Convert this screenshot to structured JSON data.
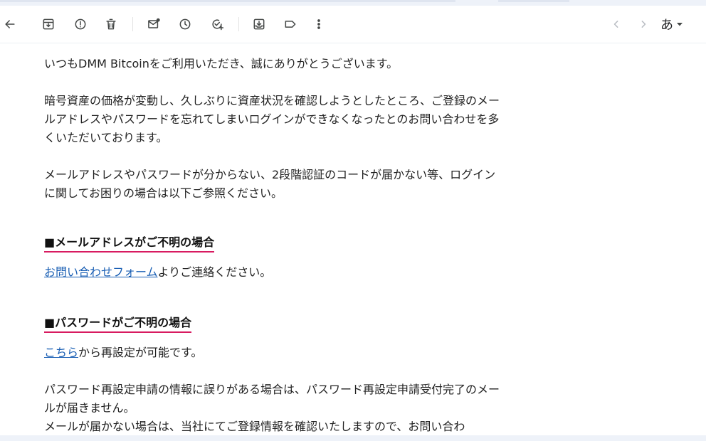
{
  "toolbar": {
    "icons": {
      "back": "arrow-left-icon",
      "archive": "archive-icon",
      "spam": "report-spam-icon",
      "delete": "trash-icon",
      "mark_unread": "mark-unread-icon",
      "snooze": "clock-icon",
      "add_task": "add-task-icon",
      "move": "move-to-icon",
      "label": "label-icon",
      "more": "more-vert-icon",
      "newer": "chevron-left-icon",
      "older": "chevron-right-icon"
    },
    "ime_label": "あ"
  },
  "email": {
    "line1": "いつもDMM Bitcoinをご利用いただき、誠にありがとうございます。",
    "para2": "暗号資産の価格が変動し、久しぶりに資産状況を確認しようとしたところ、ご登録のメールアドレスやパスワードを忘れてしまいログインができなくなったとのお問い合わせを多くいただいております。",
    "para3": "メールアドレスやパスワードが分からない、2段階認証のコードが届かない等、ログインに関してお困りの場合は以下ご参照ください。",
    "section1": {
      "heading": "■メールアドレスがご不明の場合",
      "link": "お問い合わせフォーム",
      "text": "よりご連絡ください。"
    },
    "section2": {
      "heading": "■パスワードがご不明の場合",
      "link": "こちら",
      "text": "から再設定が可能です。"
    },
    "para4": "パスワード再設定申請の情報に誤りがある場合は、パスワード再設定申請受付完了のメールが届きません。\nメールが届かない場合は、当社にてご登録情報を確認いたしますので、お問い合わ"
  },
  "colors": {
    "heading_underline": "#d81b60",
    "link": "#1a5fb4"
  }
}
